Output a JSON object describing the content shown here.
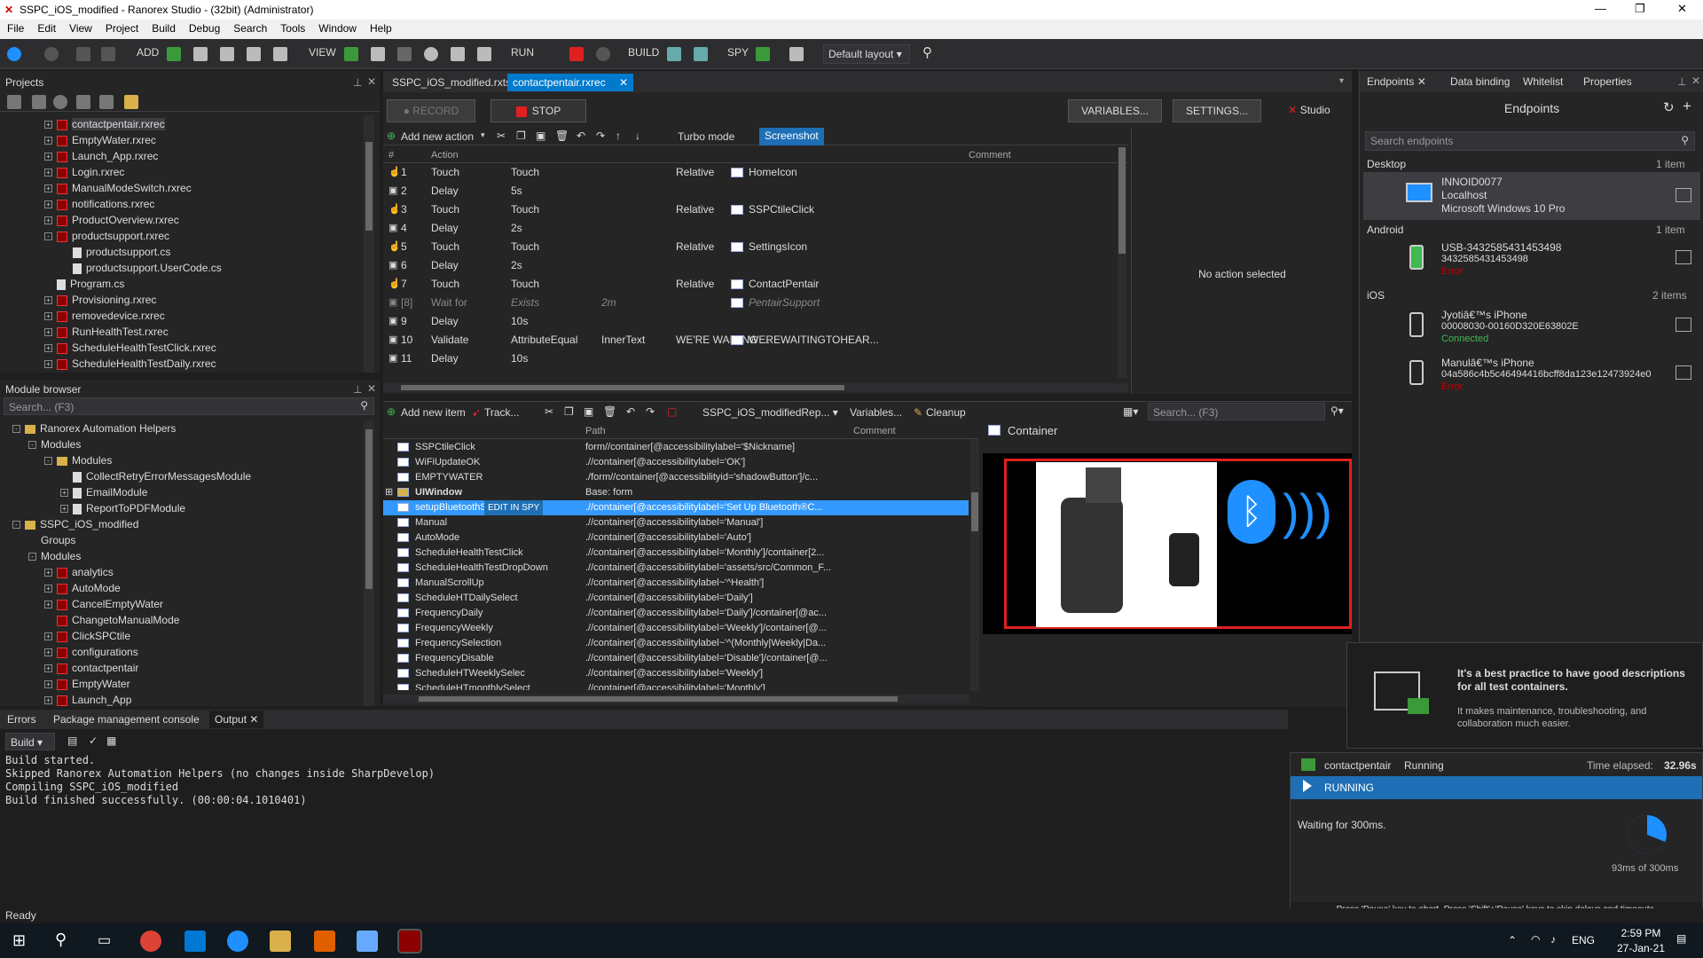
{
  "window": {
    "title": "SSPC_iOS_modified - Ranorex Studio - (32bit) (Administrator)"
  },
  "menu": [
    "File",
    "Edit",
    "View",
    "Project",
    "Build",
    "Debug",
    "Search",
    "Tools",
    "Window",
    "Help"
  ],
  "toolbar": {
    "add": "ADD",
    "view": "VIEW",
    "run": "RUN",
    "build": "BUILD",
    "spy": "SPY",
    "layout": "Default layout"
  },
  "projects": {
    "title": "Projects",
    "items": [
      {
        "label": "contactpentair.rxrec",
        "indent": 0,
        "type": "rec",
        "exp": "+"
      },
      {
        "label": "EmptyWater.rxrec",
        "indent": 0,
        "type": "rec",
        "exp": "+"
      },
      {
        "label": "Launch_App.rxrec",
        "indent": 0,
        "type": "rec",
        "exp": "+"
      },
      {
        "label": "Login.rxrec",
        "indent": 0,
        "type": "rec",
        "exp": "+"
      },
      {
        "label": "ManualModeSwitch.rxrec",
        "indent": 0,
        "type": "rec",
        "exp": "+"
      },
      {
        "label": "notifications.rxrec",
        "indent": 0,
        "type": "rec",
        "exp": "+"
      },
      {
        "label": "ProductOverview.rxrec",
        "indent": 0,
        "type": "rec",
        "exp": "+"
      },
      {
        "label": "productsupport.rxrec",
        "indent": 0,
        "type": "rec",
        "exp": "-"
      },
      {
        "label": "productsupport.cs",
        "indent": 1,
        "type": "cs",
        "exp": ""
      },
      {
        "label": "productsupport.UserCode.cs",
        "indent": 1,
        "type": "cs",
        "exp": ""
      },
      {
        "label": "Program.cs",
        "indent": 0,
        "type": "cs",
        "exp": ""
      },
      {
        "label": "Provisioning.rxrec",
        "indent": 0,
        "type": "rec",
        "exp": "+"
      },
      {
        "label": "removedevice.rxrec",
        "indent": 0,
        "type": "rec",
        "exp": "+"
      },
      {
        "label": "RunHealthTest.rxrec",
        "indent": 0,
        "type": "rec",
        "exp": "+"
      },
      {
        "label": "ScheduleHealthTestClick.rxrec",
        "indent": 0,
        "type": "rec",
        "exp": "+"
      },
      {
        "label": "ScheduleHealthTestDaily.rxrec",
        "indent": 0,
        "type": "rec",
        "exp": "+"
      }
    ]
  },
  "module_browser": {
    "title": "Module browser",
    "search": "Search... (F3)",
    "items": [
      {
        "label": "Ranorex Automation Helpers",
        "indent": 0,
        "type": "sol",
        "exp": "-"
      },
      {
        "label": "Modules",
        "indent": 1,
        "type": "none",
        "exp": "-"
      },
      {
        "label": "Modules",
        "indent": 2,
        "type": "folder",
        "exp": "-"
      },
      {
        "label": "CollectRetryErrorMessagesModule",
        "indent": 3,
        "type": "cs",
        "exp": ""
      },
      {
        "label": "EmailModule",
        "indent": 3,
        "type": "cs",
        "exp": "+"
      },
      {
        "label": "ReportToPDFModule",
        "indent": 3,
        "type": "cs",
        "exp": "+"
      },
      {
        "label": "SSPC_iOS_modified",
        "indent": 0,
        "type": "sol",
        "exp": "-"
      },
      {
        "label": "Groups",
        "indent": 1,
        "type": "none",
        "exp": ""
      },
      {
        "label": "Modules",
        "indent": 1,
        "type": "none",
        "exp": "-"
      },
      {
        "label": "analytics",
        "indent": 2,
        "type": "rec",
        "exp": "+"
      },
      {
        "label": "AutoMode",
        "indent": 2,
        "type": "rec",
        "exp": "+"
      },
      {
        "label": "CancelEmptyWater",
        "indent": 2,
        "type": "rec",
        "exp": "+"
      },
      {
        "label": "ChangetoManualMode",
        "indent": 2,
        "type": "rec",
        "exp": ""
      },
      {
        "label": "ClickSPCtile",
        "indent": 2,
        "type": "rec",
        "exp": "+"
      },
      {
        "label": "configurations",
        "indent": 2,
        "type": "rec",
        "exp": "+"
      },
      {
        "label": "contactpentair",
        "indent": 2,
        "type": "rec",
        "exp": "+"
      },
      {
        "label": "EmptyWater",
        "indent": 2,
        "type": "rec",
        "exp": "+"
      },
      {
        "label": "Launch_App",
        "indent": 2,
        "type": "rec",
        "exp": "+"
      }
    ]
  },
  "doc_tabs": {
    "tab1": "SSPC_iOS_modified.rxtst",
    "tab2": "contactpentair.rxrec"
  },
  "recorder": {
    "record": "RECORD",
    "stop": "STOP",
    "variables": "VARIABLES...",
    "settings": "SETTINGS...",
    "studio": "Studio",
    "add_action": "Add new action",
    "turbo": "Turbo mode",
    "screenshot": "Screenshot",
    "col_num": "#",
    "col_action": "Action",
    "col_comment": "Comment",
    "no_action": "No action selected",
    "rows": [
      {
        "n": "1",
        "action": "Touch",
        "p1": "Touch",
        "p2": "",
        "p3": "Relative",
        "item": "HomeIcon",
        "dim": false
      },
      {
        "n": "2",
        "action": "Delay",
        "p1": "5s",
        "p2": "",
        "p3": "",
        "item": "",
        "dim": false
      },
      {
        "n": "3",
        "action": "Touch",
        "p1": "Touch",
        "p2": "",
        "p3": "Relative",
        "item": "SSPCtileClick",
        "dim": false
      },
      {
        "n": "4",
        "action": "Delay",
        "p1": "2s",
        "p2": "",
        "p3": "",
        "item": "",
        "dim": false
      },
      {
        "n": "5",
        "action": "Touch",
        "p1": "Touch",
        "p2": "",
        "p3": "Relative",
        "item": "SettingsIcon",
        "dim": false
      },
      {
        "n": "6",
        "action": "Delay",
        "p1": "2s",
        "p2": "",
        "p3": "",
        "item": "",
        "dim": false
      },
      {
        "n": "7",
        "action": "Touch",
        "p1": "Touch",
        "p2": "",
        "p3": "Relative",
        "item": "ContactPentair",
        "dim": false
      },
      {
        "n": "[8]",
        "action": "Wait for",
        "p1": "Exists",
        "p2": "2m",
        "p3": "",
        "item": "PentairSupport",
        "dim": true
      },
      {
        "n": "9",
        "action": "Delay",
        "p1": "10s",
        "p2": "",
        "p3": "",
        "item": "",
        "dim": false
      },
      {
        "n": "10",
        "action": "Validate",
        "p1": "AttributeEqual",
        "p2": "InnerText",
        "p3": "WE'RE WAITING ...",
        "item": "WEREWAITINGTOHEAR...",
        "dim": false
      },
      {
        "n": "11",
        "action": "Delay",
        "p1": "10s",
        "p2": "",
        "p3": "",
        "item": "",
        "dim": false
      }
    ]
  },
  "repository": {
    "add_item": "Add new item",
    "track": "Track...",
    "repo_name": "SSPC_iOS_modifiedRep...",
    "variables": "Variables...",
    "cleanup": "Cleanup",
    "search": "Search... (F3)",
    "col_path": "Path",
    "col_comment": "Comment",
    "edit_in_spy": "EDIT IN SPY",
    "rows": [
      {
        "name": "SSPCtileClick",
        "path": "form//container[@accessibilitylabel='$Nickname]",
        "folder": false,
        "sel": false
      },
      {
        "name": "WiFiUpdateOK",
        "path": ".//container[@accessibilitylabel='OK']",
        "folder": false,
        "sel": false
      },
      {
        "name": "EMPTYWATER",
        "path": "./form//container[@accessibilityid='shadowButton']/c...",
        "folder": false,
        "sel": false
      },
      {
        "name": "UIWindow",
        "path": "Base: form",
        "folder": true,
        "sel": false
      },
      {
        "name": "setupBluetoothS...",
        "path": ".//container[@accessibilitylabel='Set Up Bluetooth®C...",
        "folder": false,
        "sel": true
      },
      {
        "name": "Manual",
        "path": ".//container[@accessibilitylabel='Manual']",
        "folder": false,
        "sel": false
      },
      {
        "name": "AutoMode",
        "path": ".//container[@accessibilitylabel='Auto']",
        "folder": false,
        "sel": false
      },
      {
        "name": "ScheduleHealthTestClick",
        "path": ".//container[@accessibilitylabel='Monthly']/container[2...",
        "folder": false,
        "sel": false
      },
      {
        "name": "ScheduleHealthTestDropDown",
        "path": ".//container[@accessibilitylabel='assets/src/Common_F...",
        "folder": false,
        "sel": false
      },
      {
        "name": "ManualScrollUp",
        "path": ".//container[@accessibilitylabel~'^Health']",
        "folder": false,
        "sel": false
      },
      {
        "name": "ScheduleHTDailySelect",
        "path": ".//container[@accessibilitylabel='Daily']",
        "folder": false,
        "sel": false
      },
      {
        "name": "FrequencyDaily",
        "path": ".//container[@accessibilitylabel='Daily']/container[@ac...",
        "folder": false,
        "sel": false
      },
      {
        "name": "FrequencyWeekly",
        "path": ".//container[@accessibilitylabel='Weekly']/container[@...",
        "folder": false,
        "sel": false
      },
      {
        "name": "FrequencySelection",
        "path": ".//container[@accessibilitylabel~'^(Monthly|Weekly|Da...",
        "folder": false,
        "sel": false
      },
      {
        "name": "FrequencyDisable",
        "path": ".//container[@accessibilitylabel='Disable']/container[@...",
        "folder": false,
        "sel": false
      },
      {
        "name": "ScheduleHTWeeklySelec",
        "path": ".//container[@accessibilitylabel='Weekly']",
        "folder": false,
        "sel": false
      },
      {
        "name": "ScheduleHTmonthlySelect",
        "path": ".//container[@accessibilitylabel='Monthly']",
        "folder": false,
        "sel": false
      }
    ],
    "preview_title": "Container"
  },
  "right_tabs": {
    "endpoints": "Endpoints",
    "data_binding": "Data binding",
    "whitelist": "Whitelist",
    "properties": "Properties"
  },
  "endpoints": {
    "title": "Endpoints",
    "search": "Search endpoints",
    "desktop": {
      "label": "Desktop",
      "count": "1 item",
      "name": "INNOID0077",
      "l2": "Localhost",
      "l3": "Microsoft Windows 10 Pro"
    },
    "android": {
      "label": "Android",
      "count": "1 item",
      "name": "USB-3432585431453498",
      "l2": "3432585431453498",
      "status": "Error"
    },
    "ios": {
      "label": "iOS",
      "count": "2 items",
      "d1": {
        "name": "Jyotiâ€™s iPhone",
        "l2": "00008030-00160D320E63802E",
        "status": "Connected"
      },
      "d2": {
        "name": "Manulâ€™s iPhone",
        "l2": "04a586c4b5c46494416bcff8da123e12473924e0",
        "status": "Error"
      }
    }
  },
  "tip": {
    "title": "It's a best practice to have good descriptions for all test containers.",
    "body": "It makes maintenance, troubleshooting, and collaboration much easier."
  },
  "runner": {
    "name": "contactpentair",
    "state": "Running",
    "elapsed_label": "Time elapsed:",
    "elapsed": "32.96s",
    "banner": "RUNNING",
    "waiting": "Waiting for 300ms.",
    "progress_text": "93ms of 300ms",
    "progress": 0.31,
    "footer": "Press 'Pause' key to abort. Press 'Shift'+'Pause' keys to skip delays and timeouts."
  },
  "bottom": {
    "tab_errors": "Errors",
    "tab_pkg": "Package management console",
    "tab_output": "Output",
    "build": "Build",
    "lines": [
      "Build started.",
      "Skipped Ranorex Automation Helpers (no changes inside SharpDevelop)",
      "Compiling SSPC_iOS_modified",
      "Build finished successfully. (00:00:04.1010401)"
    ]
  },
  "status": "Ready",
  "taskbar": {
    "lang": "ENG",
    "time": "2:59 PM",
    "date": "27-Jan-21"
  },
  "colors": {
    "accent": "#007acc",
    "selected": "#3399ff",
    "stop": "#e02020",
    "error": "#c00000",
    "connected": "#3fb950"
  }
}
